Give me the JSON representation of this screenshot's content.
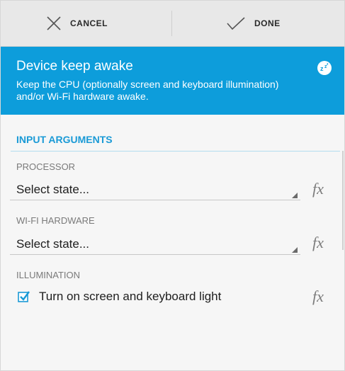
{
  "actionbar": {
    "cancel_label": "CANCEL",
    "done_label": "DONE"
  },
  "header": {
    "title": "Device keep awake",
    "description": "Keep the CPU (optionally screen and keyboard illumination) and/or Wi-Fi hardware awake.",
    "icon": "sleep-zz-icon",
    "background": "#0d9ddb"
  },
  "section": {
    "title": "INPUT ARGUMENTS",
    "accent": "#1a9ad6"
  },
  "fields": {
    "processor": {
      "label": "PROCESSOR",
      "value": "Select state..."
    },
    "wifi": {
      "label": "WI-FI HARDWARE",
      "value": "Select state..."
    },
    "illumination": {
      "label": "ILLUMINATION",
      "checkbox_label": "Turn on screen and keyboard light",
      "checked": true
    }
  },
  "fx_icon_text": "fx"
}
